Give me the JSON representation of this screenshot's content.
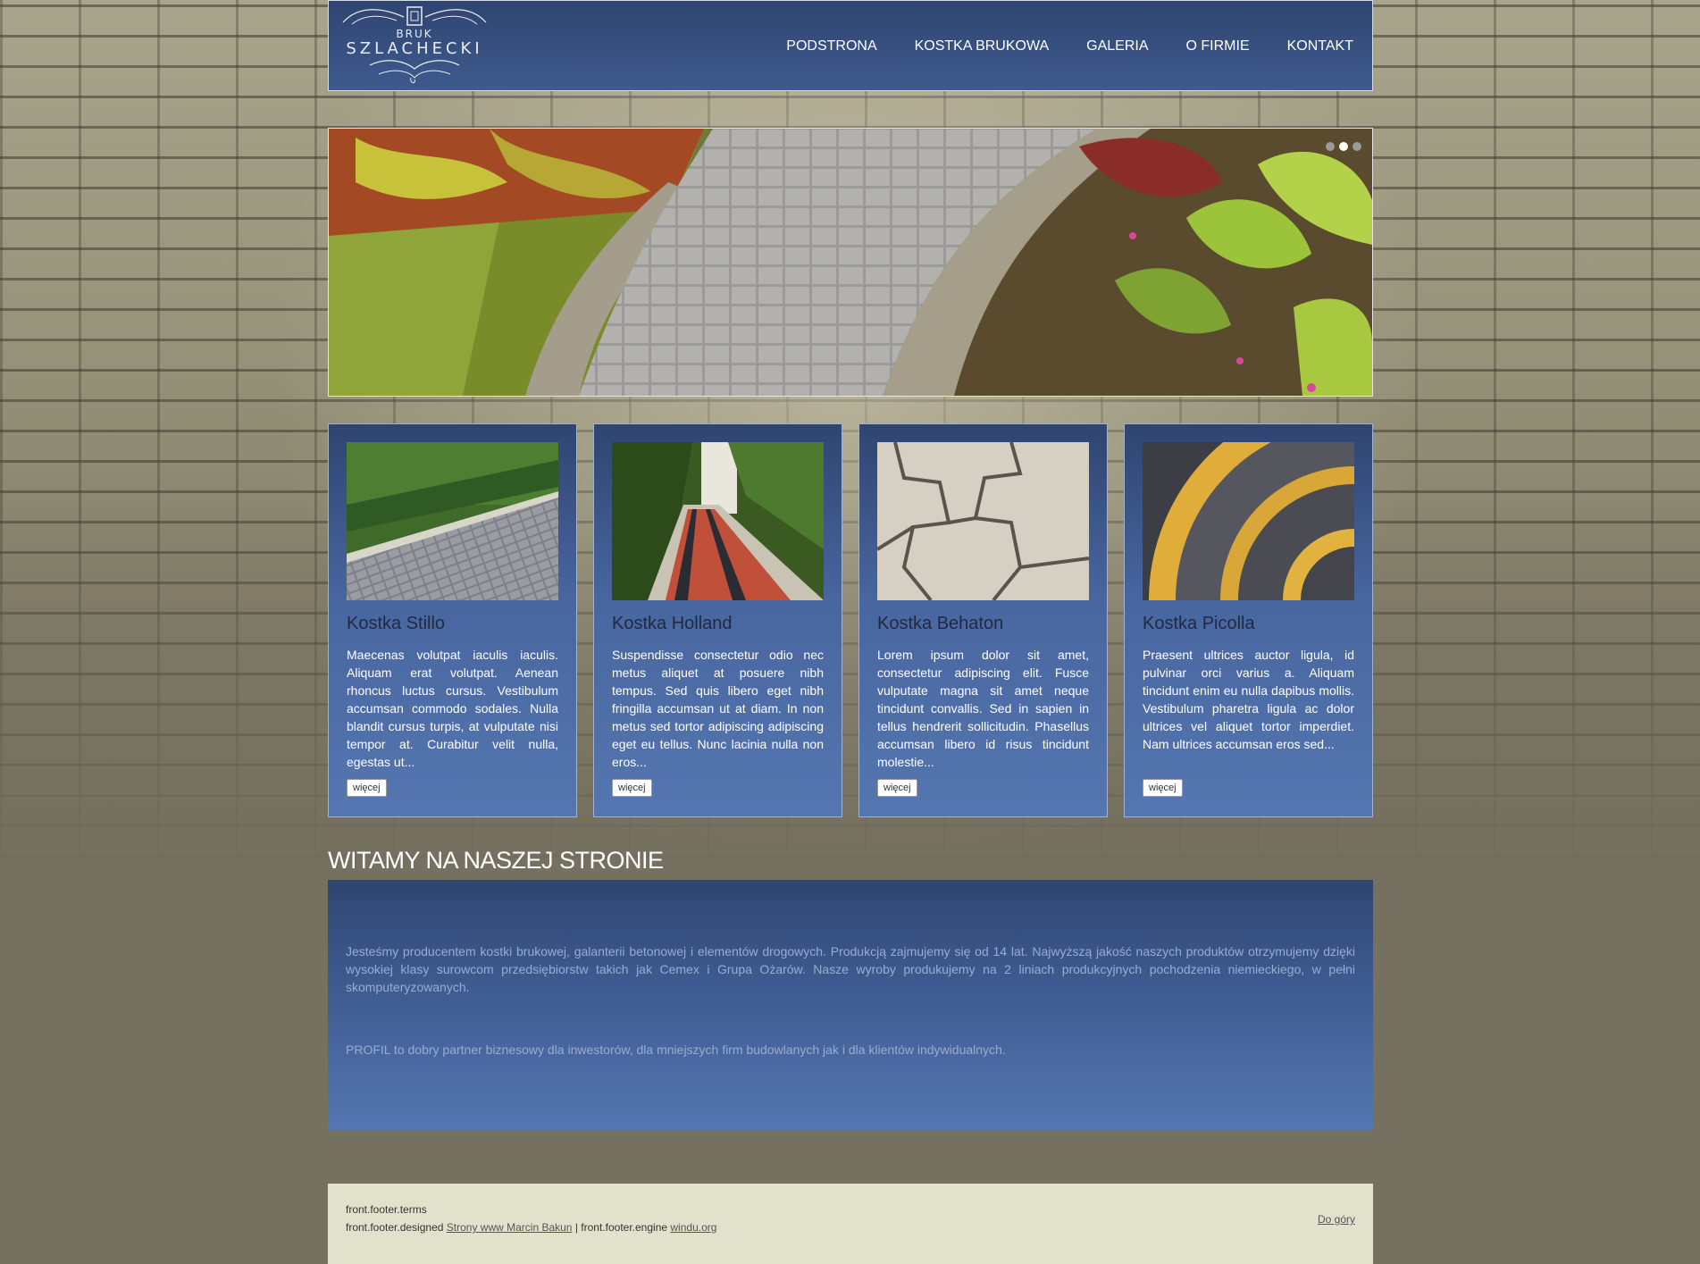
{
  "brand": {
    "line1": "BRUK",
    "line2": "SZLACHECKI"
  },
  "nav": {
    "items": [
      {
        "label": "PODSTRONA"
      },
      {
        "label": "KOSTKA BRUKOWA"
      },
      {
        "label": "GALERIA"
      },
      {
        "label": "O FIRMIE"
      },
      {
        "label": "KONTAKT"
      }
    ]
  },
  "slider": {
    "dots": 3,
    "active_dot": 2
  },
  "cards": [
    {
      "title": "Kostka Stillo",
      "text": "Maecenas volutpat iaculis iaculis. Aliquam erat volutpat. Aenean rhoncus luctus cursus. Vestibulum accumsan commodo sodales. Nulla blandit cursus turpis, at vulputate nisi tempor at. Curabitur velit nulla, egestas ut...",
      "button": "więcej"
    },
    {
      "title": "Kostka Holland",
      "text": "Suspendisse consectetur odio nec metus aliquet at posuere nibh tempus. Sed quis libero eget nibh fringilla accumsan ut at diam. In non metus sed tortor adipiscing adipiscing eget eu tellus. Nunc lacinia nulla non eros...",
      "button": "więcej"
    },
    {
      "title": "Kostka Behaton",
      "text": "Lorem ipsum dolor sit amet, consectetur adipiscing elit. Fusce vulputate magna sit amet neque tincidunt convallis. Sed in sapien in tellus hendrerit sollicitudin. Phasellus accumsan libero id risus tincidunt molestie...",
      "button": "więcej"
    },
    {
      "title": "Kostka Picolla",
      "text": "Praesent ultrices auctor ligula, id pulvinar orci varius a. Aliquam tincidunt enim eu nulla dapibus mollis. Vestibulum pharetra ligula ac dolor ultrices vel aliquet tortor imperdiet. Nam ultrices accumsan eros sed...",
      "button": "więcej"
    }
  ],
  "welcome": {
    "title": "WITAMY NA NASZEJ STRONIE",
    "p1": "Jesteśmy producentem kostki brukowej, galanterii betonowej i elementów drogowych. Produkcją zajmujemy się od 14 lat. Najwyższą jakość naszych produktów otrzymujemy dzięki wysokiej klasy surowcom przedsiębiorstw takich jak Cemex i Grupa Ożarów. Nasze wyroby produkujemy na 2 liniach produkcyjnych pochodzenia niemieckiego, w pełni skomputeryzowanych.",
    "p2": "PROFIL to dobry partner biznesowy dla inwestorów, dla mniejszych firm budowlanych jak i dla klientów indywidualnych."
  },
  "footer": {
    "terms": "front.footer.terms",
    "designed": "front.footer.designed",
    "designer_link": "Strony www Marcin Bakun",
    "separator": "|",
    "engine": "front.footer.engine",
    "engine_link": "windu.org",
    "top_link": "Do góry"
  },
  "colors": {
    "header_blue": "#2f4570",
    "card_blue": "#5576b0",
    "footer_bg": "#e2e1cc",
    "page_bg": "#75705f"
  },
  "icons": [
    "logo-ornament-icon"
  ]
}
